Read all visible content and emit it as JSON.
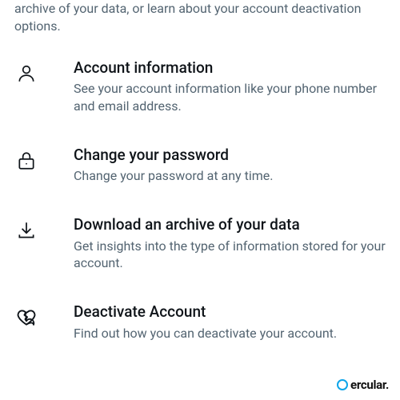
{
  "header": {
    "desc_partial": "archive of your data, or learn about your account deactivation options."
  },
  "items": [
    {
      "title": "Account information",
      "desc": "See your account information like your phone number and email address."
    },
    {
      "title": "Change your password",
      "desc": "Change your password at any time."
    },
    {
      "title": "Download an archive of your data",
      "desc": "Get insights into the type of information stored for your account."
    },
    {
      "title": "Deactivate Account",
      "desc": "Find out how you can deactivate your account."
    }
  ],
  "watermark": {
    "text": "ercular."
  }
}
